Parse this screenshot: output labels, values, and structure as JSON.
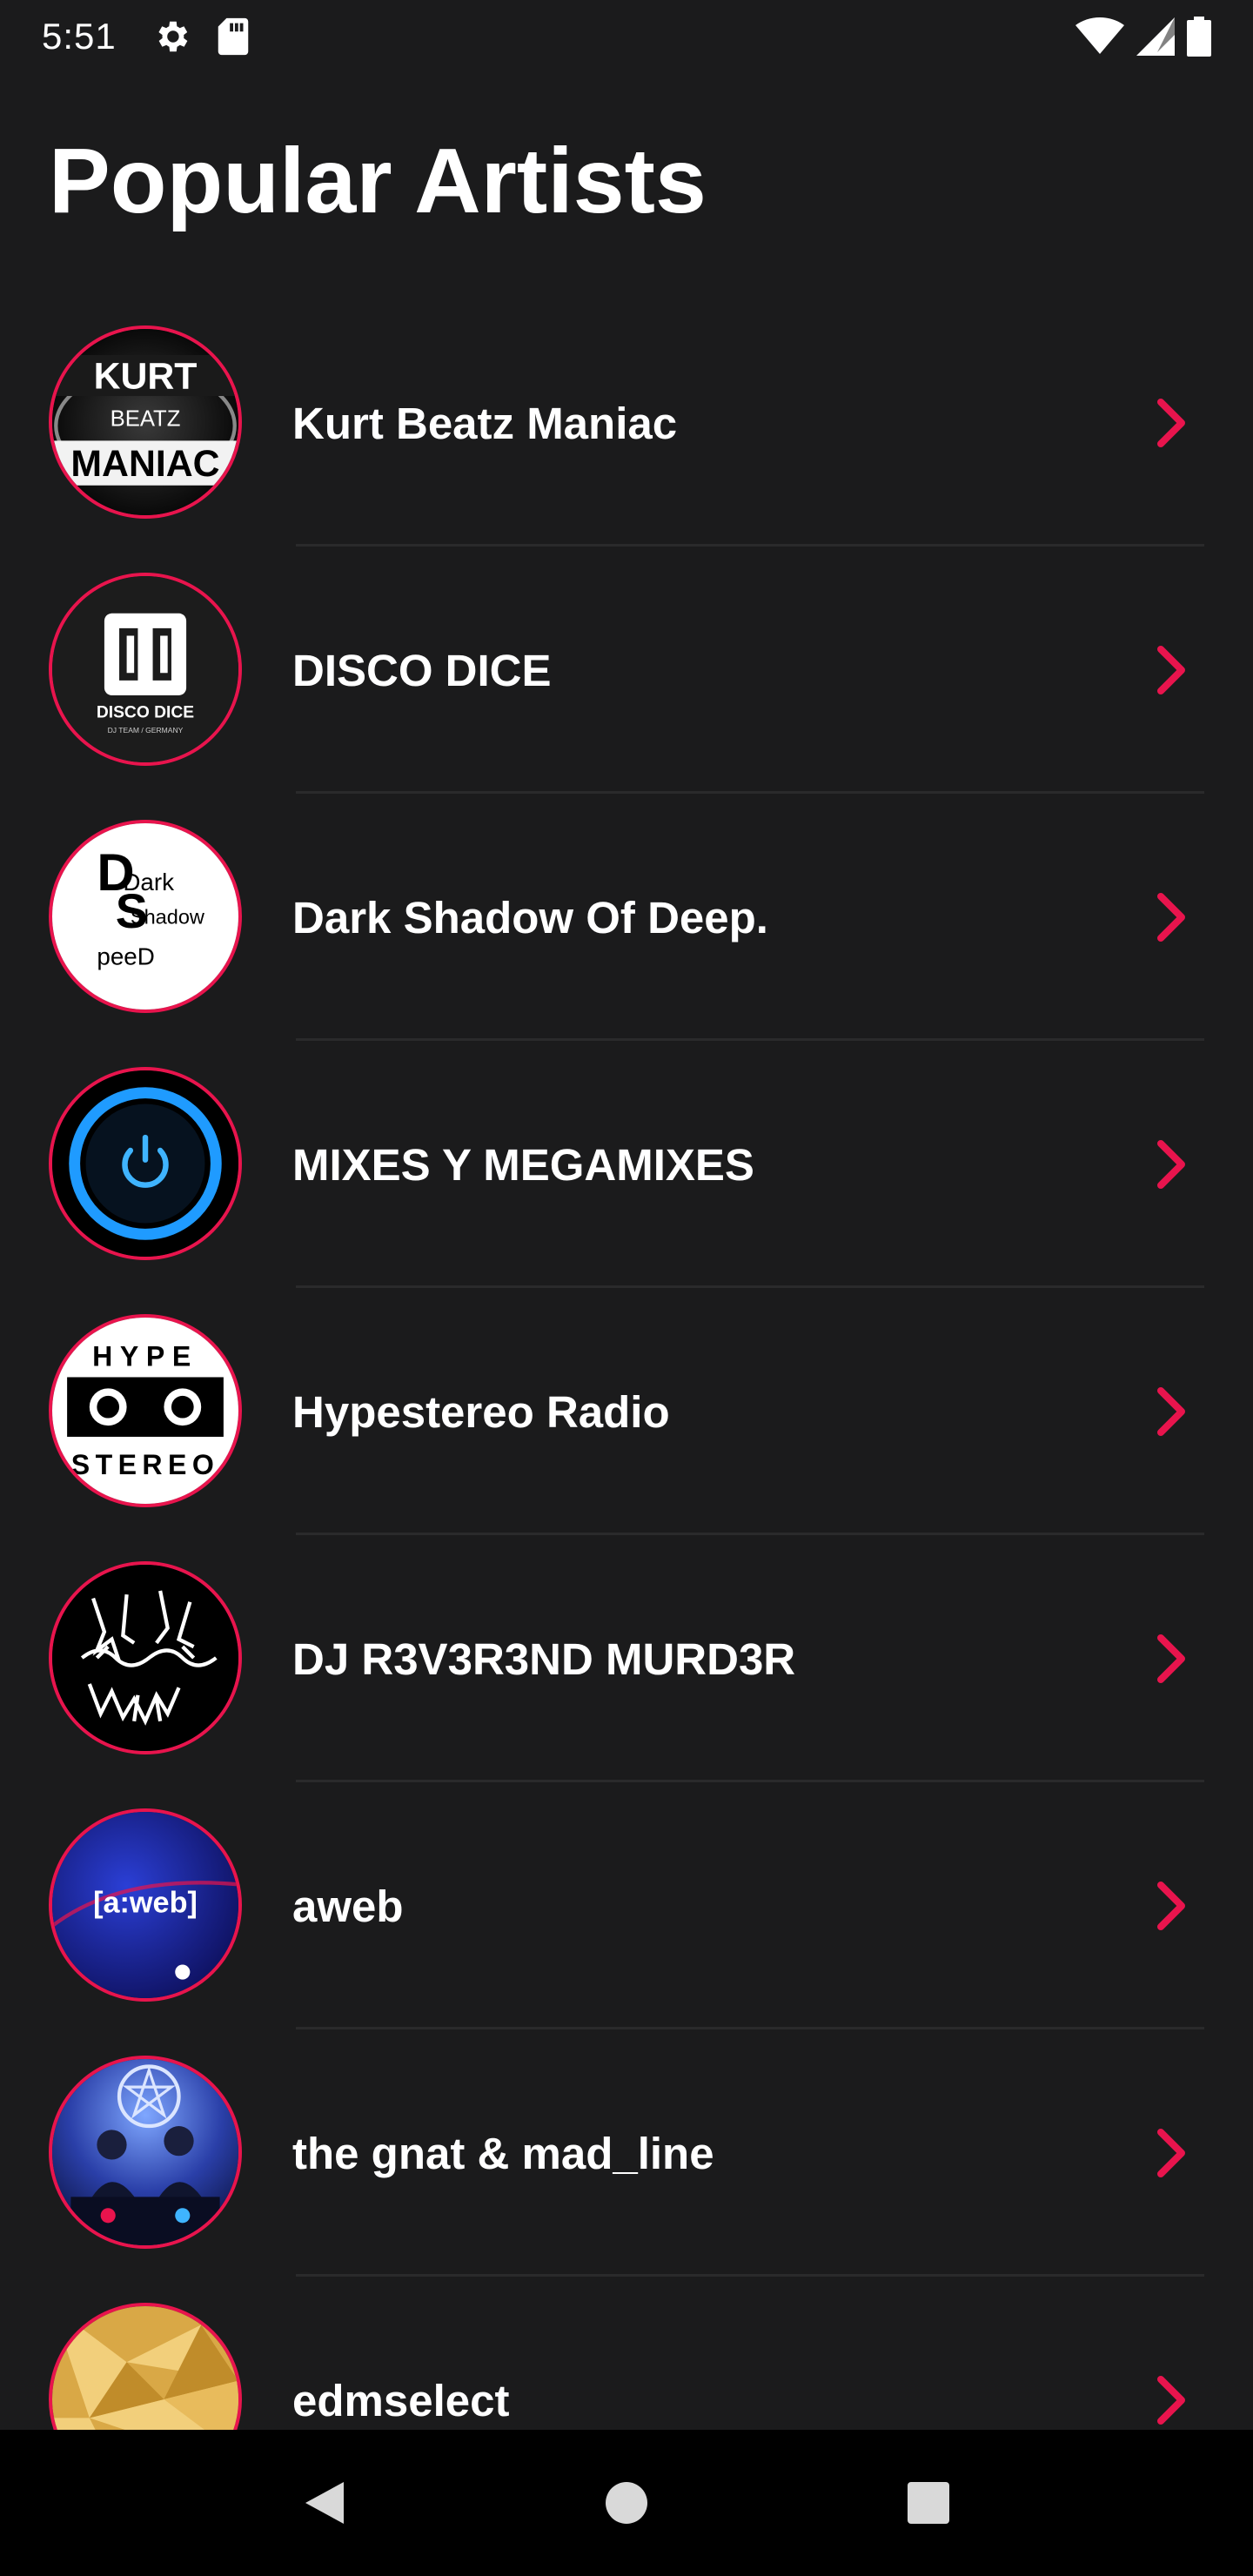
{
  "status_bar": {
    "time": "5:51",
    "icons_left": [
      "settings-icon",
      "sd-card-icon"
    ],
    "icons_right": [
      "wifi-icon",
      "signal-icon",
      "battery-icon"
    ]
  },
  "header": {
    "title": "Popular Artists"
  },
  "artists": [
    {
      "name": "Kurt Beatz Maniac",
      "avatar_text": [
        "KURT",
        "BEATZ",
        "MANIAC"
      ]
    },
    {
      "name": "DISCO DICE",
      "avatar_text": [
        "DISCO DICE",
        "DJ TEAM / GERMANY"
      ]
    },
    {
      "name": "Dark Shadow Of Deep.",
      "avatar_text": [
        "Dark",
        "Shadow",
        "peeD"
      ]
    },
    {
      "name": "MIXES Y MEGAMIXES",
      "avatar_text": []
    },
    {
      "name": "Hypestereo Radio",
      "avatar_text": [
        "HYPE",
        "STEREO"
      ]
    },
    {
      "name": "DJ R3V3R3ND MURD3R",
      "avatar_text": []
    },
    {
      "name": "aweb",
      "avatar_text": [
        "[a:web]"
      ]
    },
    {
      "name": "the gnat & mad_line",
      "avatar_text": []
    },
    {
      "name": "edmselect",
      "avatar_text": []
    }
  ],
  "nav_bar": {
    "buttons": [
      "back-icon",
      "home-icon",
      "recents-icon"
    ]
  },
  "colors": {
    "background": "#1b1b1c",
    "accent": "#e8144d",
    "text": "#ffffff",
    "divider": "#2a2a2b"
  }
}
